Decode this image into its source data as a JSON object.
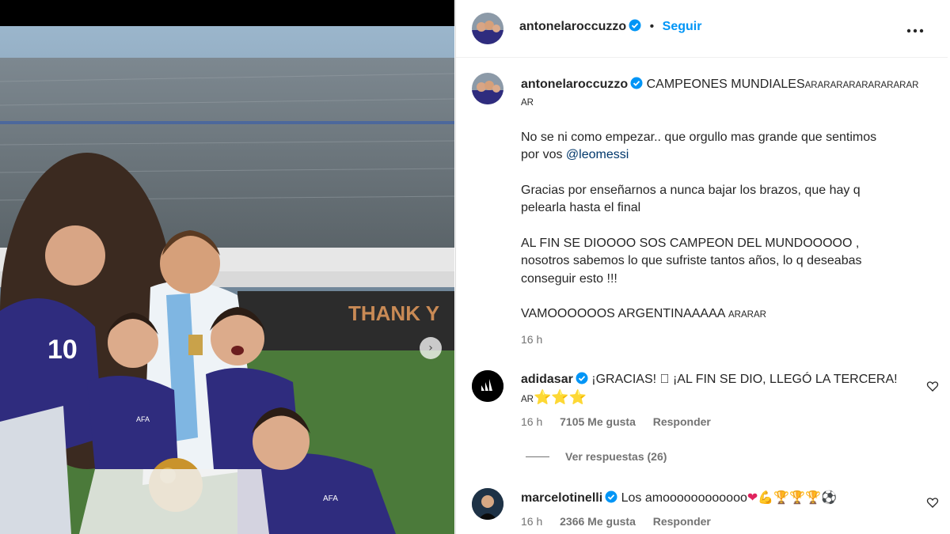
{
  "photo": {
    "banner_text": "THANK Y",
    "jersey_number": "10",
    "crest_text": "AFA"
  },
  "post": {
    "author": "antonelaroccuzzo",
    "bullet": "•",
    "follow_label": "Seguir",
    "more_icon": "more-horizontal-icon",
    "caption_author": "antonelaroccuzzo",
    "caption_title": "CAMPEONES MUNDIALES",
    "caption_flags": "ARARARARARARARARAR",
    "caption_flags_2": "AR",
    "para1_a": "No se ni como empezar.. que orgullo mas grande que sentimos",
    "para1_b": "por vos ",
    "para1_mention": "@leomessi",
    "para2_a": "Gracias por enseñarnos a nunca bajar los brazos, que hay q",
    "para2_b": "pelearla hasta el final",
    "para3_a": "AL FIN SE DIOOOO SOS CAMPEON DEL MUNDOOOOO ,",
    "para3_b": "nosotros sabemos lo que sufriste tantos años, lo q deseabas",
    "para3_c": "conseguir esto !!!",
    "para4": "VAMOOOOOOS ARGENTINAAAAA",
    "para4_flags": "ARARAR",
    "time": "16 h"
  },
  "comments": [
    {
      "user": "adidasar",
      "text": "¡GRACIAS! ⃞ ¡AL FIN SE DIO, LLEGÓ LA TERCERA!",
      "text_2_prefix": "AR",
      "stars": "⭐⭐⭐",
      "time": "16 h",
      "likes": "7105 Me gusta",
      "reply": "Responder",
      "view_replies": "Ver respuestas (26)"
    },
    {
      "user": "marcelotinelli",
      "text": "Los amoooooooooooo",
      "emojis": "❤💪🏆🏆🏆⚽",
      "time": "16 h",
      "likes": "2366 Me gusta",
      "reply": "Responder"
    }
  ],
  "colors": {
    "accent": "#0095f6",
    "verified": "#0095f6",
    "mention": "#00376b",
    "muted": "#737373"
  }
}
